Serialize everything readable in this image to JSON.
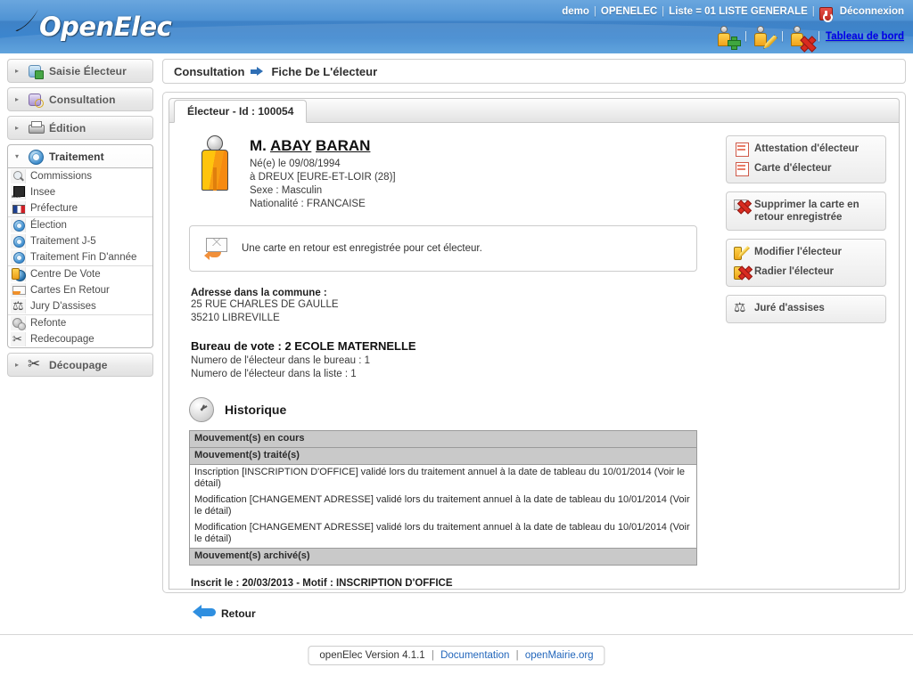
{
  "header": {
    "logo_text": "OpenElec",
    "user": "demo",
    "organization": "OPENELEC",
    "list_label": "Liste = 01 LISTE GENERALE",
    "logout_label": "Déconnexion",
    "logout_icon": "power-icon",
    "separator": "|",
    "action_icons": [
      {
        "name": "add-elector-icon",
        "icon": "person-add-icon"
      },
      {
        "name": "edit-elector-icon",
        "icon": "person-edit-icon"
      },
      {
        "name": "delete-elector-icon",
        "icon": "person-delete-icon"
      }
    ],
    "dashboard_label": "Tableau de bord"
  },
  "sidebar": {
    "menus": [
      {
        "label": "Saisie Électeur",
        "icon": "people-add-icon",
        "open": false,
        "chevron": "▸"
      },
      {
        "label": "Consultation",
        "icon": "people-search-icon",
        "open": false,
        "chevron": "▸"
      },
      {
        "label": "Édition",
        "icon": "printer-icon",
        "open": false,
        "chevron": "▸"
      },
      {
        "label": "Traitement",
        "icon": "gear-icon",
        "open": true,
        "chevron": "▾"
      },
      {
        "label": "Découpage",
        "icon": "scissors-icon",
        "open": false,
        "chevron": "▸"
      }
    ],
    "traitement_groups": [
      [
        {
          "label": "Commissions",
          "icon": "magnifier-icon"
        },
        {
          "label": "Insee",
          "icon": "insee-icon"
        },
        {
          "label": "Préfecture",
          "icon": "french-flag-icon"
        }
      ],
      [
        {
          "label": "Élection",
          "icon": "gear-blue-icon"
        },
        {
          "label": "Traitement J-5",
          "icon": "gear-blue-icon"
        },
        {
          "label": "Traitement Fin D'année",
          "icon": "gear-blue-icon"
        }
      ],
      [
        {
          "label": "Centre De Vote",
          "icon": "globe-person-icon"
        },
        {
          "label": "Cartes En Retour",
          "icon": "envelope-return-icon"
        },
        {
          "label": "Jury D'assises",
          "icon": "scales-icon"
        }
      ],
      [
        {
          "label": "Refonte",
          "icon": "gears-gray-icon"
        },
        {
          "label": "Redecoupage",
          "icon": "scissors-small-icon"
        }
      ]
    ]
  },
  "breadcrumb": {
    "root": "Consultation",
    "arrow_icon": "arrow-right-icon",
    "current": "Fiche De L'électeur"
  },
  "tab": {
    "label": "Électeur - Id : 100054"
  },
  "elector": {
    "avatar_icon": "person-avatar-icon",
    "title": "M.",
    "first_name": "ABAY",
    "last_name": "BARAN",
    "full_name": "M. ABAY BARAN",
    "birth_line": "Né(e) le 09/08/1994",
    "birth_place_line": "à DREUX [EURE-ET-LOIR (28)]",
    "sex_line": "Sexe : Masculin",
    "nationality_line": "Nationalité : FRANCAISE"
  },
  "notice": {
    "icon": "envelope-return-icon",
    "text": "Une carte en retour est enregistrée pour cet électeur."
  },
  "address": {
    "title": "Adresse dans la commune :",
    "lines": [
      "25 RUE CHARLES DE GAULLE",
      "35210 LIBREVILLE"
    ]
  },
  "bureau": {
    "title": "Bureau de vote : 2 ECOLE MATERNELLE",
    "lines": [
      "Numero de l'électeur dans le bureau : 1",
      "Numero de l'électeur dans la liste : 1"
    ]
  },
  "historique": {
    "icon": "clock-icon",
    "title": "Historique",
    "rows": [
      {
        "type": "section",
        "text": "Mouvement(s) en cours"
      },
      {
        "type": "section",
        "text": "Mouvement(s) traité(s)"
      },
      {
        "type": "entry",
        "text": "Inscription [INSCRIPTION D'OFFICE] validé lors du traitement annuel à la date de tableau du 10/01/2014 (Voir le détail)"
      },
      {
        "type": "entry",
        "text": "Modification [CHANGEMENT ADRESSE] validé lors du traitement annuel à la date de tableau du 10/01/2014 (Voir le détail)"
      },
      {
        "type": "entry",
        "text": "Modification [CHANGEMENT ADRESSE] validé lors du traitement annuel à la date de tableau du 10/01/2014 (Voir le détail)"
      },
      {
        "type": "section",
        "text": "Mouvement(s) archivé(s)"
      }
    ]
  },
  "inscription": {
    "text": "Inscrit le : 20/03/2013 - Motif : INSCRIPTION D'OFFICE"
  },
  "back": {
    "icon": "back-arrow-icon",
    "label": "Retour"
  },
  "actions": {
    "groups": [
      {
        "items": [
          {
            "label": "Attestation d'électeur",
            "icon": "document-red-icon"
          },
          {
            "label": "Carte d'électeur",
            "icon": "document-red-icon"
          }
        ]
      },
      {
        "items": [
          {
            "label": "Supprimer la carte en retour enregistrée",
            "icon": "card-delete-icon"
          }
        ]
      },
      {
        "items": [
          {
            "label": "Modifier l'électeur",
            "icon": "pencil-yellow-icon"
          },
          {
            "label": "Radier l'électeur",
            "icon": "person-delete-icon"
          }
        ]
      },
      {
        "items": [
          {
            "label": "Juré d'assises",
            "icon": "scales-icon"
          }
        ]
      }
    ]
  },
  "footer": {
    "version": "openElec Version 4.1.1",
    "sep": "|",
    "documentation": "Documentation",
    "openmairie": "openMairie.org"
  },
  "colors": {
    "header_blue": "#3f82c6",
    "link_blue": "#2266bb",
    "accent_orange": "#f0a21b",
    "danger_red": "#d92b20",
    "table_header_gray": "#c9c9c9"
  }
}
